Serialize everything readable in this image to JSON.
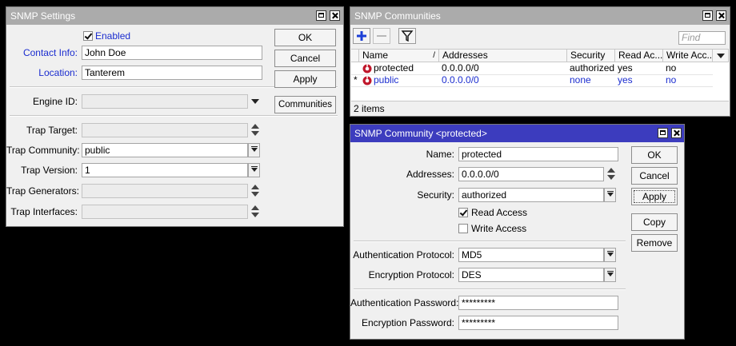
{
  "snmp_settings": {
    "title": "SNMP Settings",
    "enabled_label": "Enabled",
    "contact_label": "Contact Info:",
    "contact_value": "John Doe",
    "location_label": "Location:",
    "location_value": "Tanterem",
    "engine_label": "Engine ID:",
    "trap_target_label": "Trap Target:",
    "trap_community_label": "Trap Community:",
    "trap_community_value": "public",
    "trap_version_label": "Trap Version:",
    "trap_version_value": "1",
    "trap_generators_label": "Trap Generators:",
    "trap_interfaces_label": "Trap Interfaces:",
    "ok": "OK",
    "cancel": "Cancel",
    "apply": "Apply",
    "communities": "Communities"
  },
  "communities": {
    "title": "SNMP Communities",
    "find_placeholder": "Find",
    "columns": [
      "Name",
      "Addresses",
      "Security",
      "Read Ac...",
      "Write Acc..."
    ],
    "rows": [
      {
        "marker": "",
        "name": "protected",
        "addresses": "0.0.0.0/0",
        "security": "authorized",
        "read": "yes",
        "write": "no"
      },
      {
        "marker": "*",
        "name": "public",
        "addresses": "0.0.0.0/0",
        "security": "none",
        "read": "yes",
        "write": "no"
      }
    ],
    "status": "2 items"
  },
  "community_dialog": {
    "title": "SNMP Community <protected>",
    "name_label": "Name:",
    "name_value": "protected",
    "addresses_label": "Addresses:",
    "addresses_value": "0.0.0.0/0",
    "security_label": "Security:",
    "security_value": "authorized",
    "read_access_label": "Read Access",
    "write_access_label": "Write Access",
    "auth_proto_label": "Authentication Protocol:",
    "auth_proto_value": "MD5",
    "enc_proto_label": "Encryption Protocol:",
    "enc_proto_value": "DES",
    "auth_pass_label": "Authentication Password:",
    "auth_pass_value": "*********",
    "enc_pass_label": "Encryption Password:",
    "enc_pass_value": "*********",
    "ok": "OK",
    "cancel": "Cancel",
    "apply": "Apply",
    "copy": "Copy",
    "remove": "Remove"
  },
  "colors": {
    "active_title": "#3c3cbe",
    "inactive_title": "#ababab",
    "label_blue": "#1a2ccf"
  }
}
